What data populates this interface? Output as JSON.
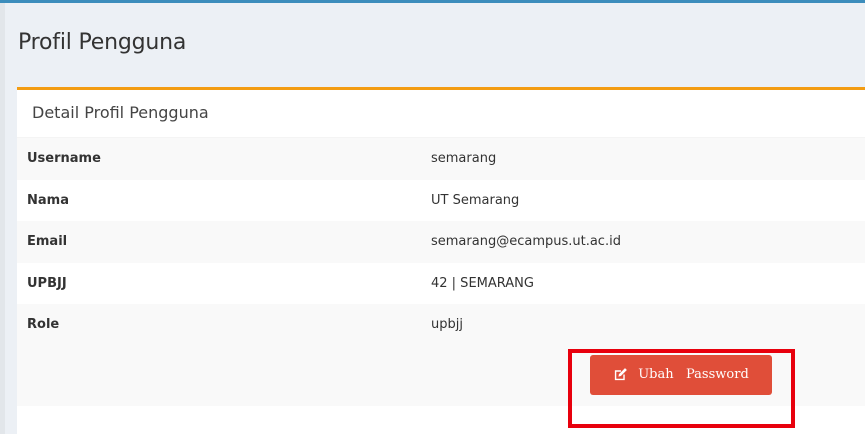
{
  "page": {
    "title": "Profil Pengguna"
  },
  "card": {
    "title": "Detail Profil Pengguna",
    "accent_color": "#f39c12",
    "rows": [
      {
        "label": "Username",
        "value": "semarang"
      },
      {
        "label": "Nama",
        "value": "UT Semarang"
      },
      {
        "label": "Email",
        "value": "semarang@ecampus.ut.ac.id"
      },
      {
        "label": "UPBJJ",
        "value": "42 | SEMARANG"
      },
      {
        "label": "Role",
        "value": "upbjj"
      }
    ]
  },
  "actions": {
    "change_password_label": "Ubah   Password",
    "change_password_icon": "edit-icon",
    "button_color": "#e04e39",
    "highlight_color": "#e8000d"
  }
}
